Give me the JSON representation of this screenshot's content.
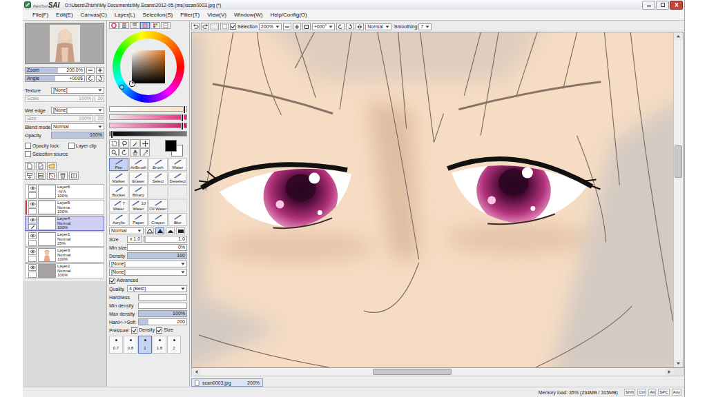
{
  "app": {
    "logo_small": "PaintTool",
    "logo_big": "SAI"
  },
  "window": {
    "title": "D:\\Users\\Zhizhi\\My Documents\\My Scans\\2012-05 (me)\\scan0003.jpg (*)"
  },
  "menu": [
    "File(F)",
    "Edit(E)",
    "Canvas(C)",
    "Layer(L)",
    "Selection(S)",
    "Filter(T)",
    "View(V)",
    "Window(W)",
    "Help/Config(O)"
  ],
  "navigator": {
    "zoom_label": "Zoom",
    "zoom": "200.0%",
    "zoom_level": 0.55,
    "angle_label": "Angle",
    "angle": "+000$",
    "angle_level": 0.5
  },
  "texture": {
    "label": "Texture",
    "value": "[None]",
    "scale_label": "Scale",
    "scale": "100%",
    "amount": "20",
    "disabled": true
  },
  "wet_edge": {
    "label": "Wet edge",
    "value": "[None]",
    "size_label": "Size",
    "size": "100%",
    "amount": "20",
    "disabled": true
  },
  "blend_mode": {
    "label": "Blend mode",
    "value": "Normal"
  },
  "opacity": {
    "label": "Opacity",
    "value": "100%",
    "level": 1
  },
  "layer_options": [
    {
      "label": "Opacity lock",
      "checked": false
    },
    {
      "label": "Layer clip",
      "checked": false
    },
    {
      "label": "Selection source",
      "checked": false
    }
  ],
  "layers": [
    {
      "name": "Layer6",
      "mode": "-%'A",
      "opacity": "100%",
      "visible": true,
      "selected": false,
      "marked": false,
      "kind": "blank"
    },
    {
      "name": "Layer5",
      "mode": "Norma",
      "opacity": "100%",
      "visible": true,
      "selected": false,
      "marked": true,
      "kind": "blank"
    },
    {
      "name": "Layer4",
      "mode": "Normal",
      "opacity": "100%",
      "visible": true,
      "selected": true,
      "marked": false,
      "kind": "blank"
    },
    {
      "name": "Layer1",
      "mode": "Normal",
      "opacity": "25%",
      "visible": true,
      "selected": false,
      "marked": false,
      "kind": "blank"
    },
    {
      "name": "Layer3",
      "mode": "Normal",
      "opacity": "100%",
      "visible": true,
      "selected": false,
      "marked": false,
      "kind": "figure"
    },
    {
      "name": "Layer2",
      "mode": "Normal",
      "opacity": "100%",
      "visible": true,
      "selected": false,
      "marked": false,
      "kind": "grey"
    }
  ],
  "color": {
    "tabs": [
      {
        "selected": false
      },
      {
        "selected": false
      },
      {
        "selected": false
      },
      {
        "selected": true
      },
      {
        "selected": false
      },
      {
        "selected": false
      }
    ],
    "current": "#000000",
    "background": "#ffffff",
    "sliders": [
      {
        "level": 0.97
      },
      {
        "level": 0.95
      },
      {
        "level": 0.95
      },
      {
        "level": 0.03
      }
    ]
  },
  "tools": [
    {
      "label": "Pen",
      "selected": true,
      "kind": "tool"
    },
    {
      "label": "AirBrush",
      "selected": false,
      "kind": "tool"
    },
    {
      "label": "Brush",
      "selected": false,
      "kind": "tool"
    },
    {
      "label": "Water",
      "selected": false,
      "kind": "tool"
    },
    {
      "label": "Marker",
      "selected": false,
      "kind": "tool"
    },
    {
      "label": "Eraser",
      "selected": false,
      "kind": "tool"
    },
    {
      "label": "Select",
      "selected": false,
      "kind": "tool"
    },
    {
      "label": "Deselect",
      "selected": false,
      "kind": "tool"
    },
    {
      "label": "Bucket",
      "selected": false,
      "kind": "tool"
    },
    {
      "label": "Binary",
      "selected": false,
      "kind": "tool"
    },
    {
      "selected": false,
      "kind": "empty"
    },
    {
      "selected": false,
      "kind": "empty"
    },
    {
      "label": "Water",
      "size": "7",
      "selected": false,
      "kind": "tool"
    },
    {
      "label": "Water",
      "size": "10",
      "selected": false,
      "kind": "tool"
    },
    {
      "label": "Oil Water",
      "selected": false,
      "kind": "tool"
    },
    {
      "selected": false,
      "kind": "empty"
    },
    {
      "label": "Acrylic",
      "selected": false,
      "kind": "tool"
    },
    {
      "label": "Paper",
      "selected": false,
      "kind": "tool"
    },
    {
      "label": "Crayon",
      "selected": false,
      "kind": "tool"
    },
    {
      "label": "Blur",
      "selected": false,
      "kind": "tool"
    }
  ],
  "brush": {
    "mode": "Normal",
    "tip_shapes": [
      {
        "selected": false
      },
      {
        "selected": true
      },
      {
        "selected": false
      },
      {
        "selected": false
      }
    ],
    "size": {
      "label": "Size",
      "multiplier": "x 1.0",
      "value": "1.0",
      "level": 0.03
    },
    "sliders": [
      {
        "label": "Min size",
        "value": "0%",
        "level": 0
      },
      {
        "label": "Density",
        "value": "100",
        "level": 1
      }
    ],
    "textures": [
      "[None]",
      "[None]"
    ],
    "advanced": {
      "label": "Advanced",
      "checked": true
    },
    "quality": {
      "label": "Quality",
      "value": "4 (Best)"
    },
    "advanced_sliders": [
      {
        "label": "Hardness",
        "value": "",
        "level": 0.02
      },
      {
        "label": "Min density",
        "value": "",
        "level": 0
      },
      {
        "label": "Max density",
        "value": "100%",
        "level": 1
      },
      {
        "label": "Hard<->Soft",
        "value": "200",
        "level": 0.2
      }
    ],
    "pressure": {
      "label": "Pressure:",
      "options": [
        {
          "label": "Density",
          "checked": true
        },
        {
          "label": "Size",
          "checked": true
        }
      ]
    },
    "presets": [
      {
        "label": "0.7",
        "selected": false
      },
      {
        "label": "0.8",
        "selected": false
      },
      {
        "label": "1",
        "selected": true
      },
      {
        "label": "1.8",
        "selected": false
      },
      {
        "label": "2",
        "selected": false
      }
    ]
  },
  "canvas_toolbar": {
    "selection": {
      "label": "Selection",
      "checked": true
    },
    "zoom": "200%",
    "angle": "+000°",
    "mode": "Normal",
    "smoothing_label": "Smoothing",
    "smoothing": "7"
  },
  "scrollbars": {
    "vertical": {
      "start": 0.33,
      "size": 0.1
    },
    "horizontal": {
      "start": 0.37,
      "size": 0.17
    }
  },
  "document_tab": {
    "name": "scan0003.jpg",
    "zoom": "200%"
  },
  "status_bar": {
    "memory": "Memory load: 35% (234MB / 315MB)",
    "keys": [
      "Shift",
      "Ctrl",
      "Alt",
      "SPC",
      "Any"
    ]
  }
}
